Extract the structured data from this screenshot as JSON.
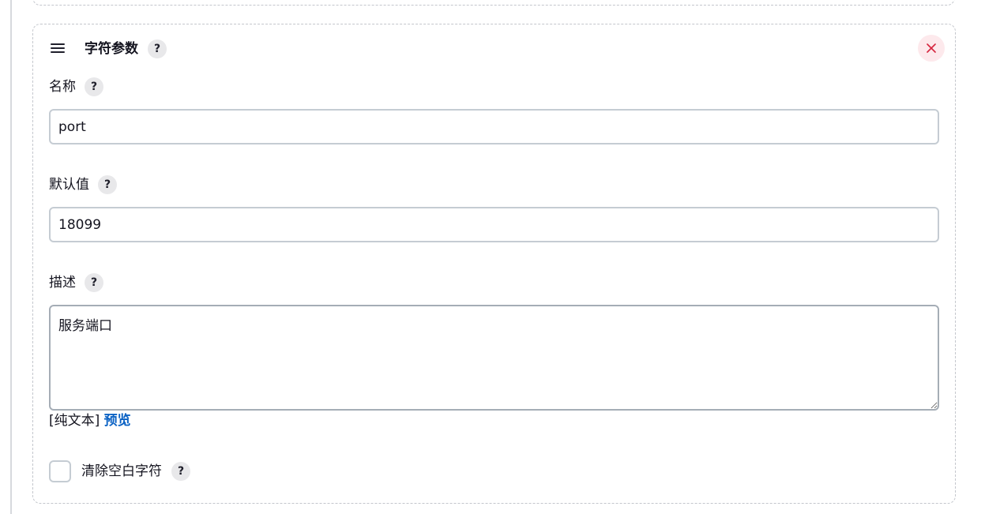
{
  "card": {
    "title": "字符参数",
    "help_glyph": "?"
  },
  "fields": {
    "name": {
      "label": "名称",
      "value": "port"
    },
    "default_value": {
      "label": "默认值",
      "value": "18099"
    },
    "description": {
      "label": "描述",
      "value": "服务端口"
    }
  },
  "format": {
    "plain_text": "[纯文本]",
    "preview": "预览"
  },
  "trim": {
    "label": "清除空白字符",
    "checked": false
  },
  "icons": {
    "drag": "drag-handle-icon",
    "help": "help-icon",
    "close": "close-icon"
  },
  "colors": {
    "link": "#0b62c4",
    "close_bg": "#fde9ec",
    "close_x": "#d6263e"
  }
}
